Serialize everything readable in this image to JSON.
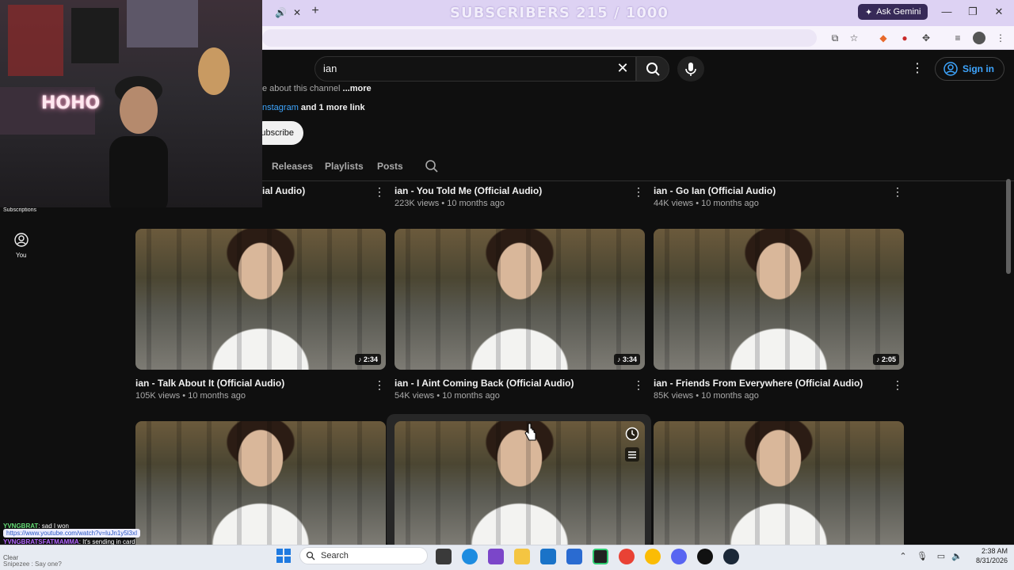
{
  "overlay": {
    "subscribers_text": "SUBSCRIBERS 215 / 1000"
  },
  "browser": {
    "ask_gemini": "Ask Gemini",
    "new_tab": "+",
    "tab_close": "✕"
  },
  "search": {
    "query": "ian",
    "clear": "✕"
  },
  "header": {
    "sign_in": "Sign in",
    "menu": "⋮"
  },
  "channel": {
    "about_text": "e about this channel",
    "about_more": "...more",
    "links_prefix": "nstagram",
    "links_suffix": " and 1 more link",
    "subscribe_label": "ubscribe"
  },
  "tabs": [
    {
      "label": "Releases"
    },
    {
      "label": "Playlists"
    },
    {
      "label": "Posts"
    }
  ],
  "left_nav": {
    "subscriptions": "Subscriptions",
    "you": "You"
  },
  "videos_row0": [
    {
      "title": "ial Audio)",
      "meta": ""
    },
    {
      "title": "ian - You Told Me (Official Audio)",
      "meta": "223K views • 10 months ago"
    },
    {
      "title": "ian - Go Ian (Official Audio)",
      "meta": "44K views • 10 months ago"
    }
  ],
  "videos_row1": [
    {
      "title": "ian - Talk About It (Official Audio)",
      "meta": "105K views • 10 months ago",
      "duration": "♪ 2:34"
    },
    {
      "title": "ian - I Aint Coming Back (Official Audio)",
      "meta": "54K views • 10 months ago",
      "duration": "♪ 3:34"
    },
    {
      "title": "ian - Friends From Everywhere (Official Audio)",
      "meta": "85K views • 10 months ago",
      "duration": "♪ 2:05"
    }
  ],
  "webcam": {
    "neon_text": "HOHO"
  },
  "chat": {
    "user1": "YVNGBRAT",
    "msg1": ": sad I won",
    "url": "https://www.youtube.com/watch?v=luJn1y5l3xI",
    "user2": "YVNGBRATSFATMAMMA",
    "msg2": ": It's sending in card",
    "line3": "Snipezee : Say one?",
    "clear": "Clear"
  },
  "taskbar": {
    "search_placeholder": "Search",
    "time": "2:38 AM",
    "date": "8/31/2026"
  }
}
